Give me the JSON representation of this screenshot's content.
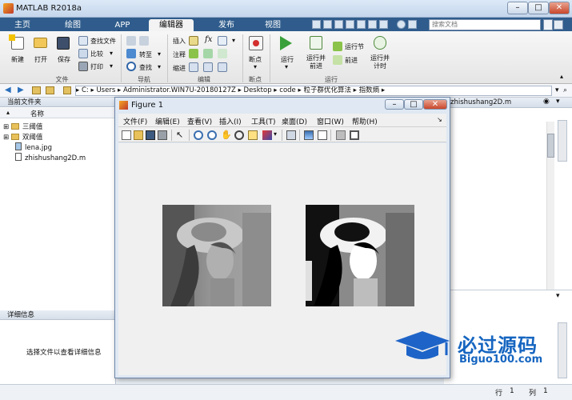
{
  "app": {
    "title": "MATLAB R2018a"
  },
  "tabs": [
    {
      "label": "主页"
    },
    {
      "label": "绘图"
    },
    {
      "label": "APP"
    },
    {
      "label": "编辑器"
    },
    {
      "label": "发布"
    },
    {
      "label": "视图"
    }
  ],
  "search": {
    "placeholder": "搜索文档"
  },
  "ribbon": {
    "new": "新建",
    "open": "打开",
    "save": "保存",
    "find_files": "查找文件",
    "compare": "比较",
    "print": "打印",
    "insert": "插入",
    "comment": "注释",
    "indent": "缩进",
    "goto": "转至",
    "find": "查找",
    "breakpoints": "断点",
    "run": "运行",
    "run_advance": "运行并\n前进",
    "run_section": "运行节",
    "advance": "前进",
    "run_time": "运行并\n计时",
    "groups": {
      "file": "文件",
      "navigate": "导航",
      "edit": "编辑",
      "breakpoints": "断点",
      "run": "运行"
    }
  },
  "address": {
    "path": [
      "C:",
      "Users",
      "Administrator.WIN7U-20180127Z",
      "Desktop",
      "code",
      "粒子群优化算法",
      "指数熵"
    ]
  },
  "current_folder": {
    "title": "当前文件夹",
    "column_name": "名称",
    "items": [
      {
        "name": "三阈值",
        "type": "folder"
      },
      {
        "name": "双阈值",
        "type": "folder"
      },
      {
        "name": "lena.jpg",
        "type": "file"
      },
      {
        "name": "zhishushang2D.m",
        "type": "file"
      }
    ]
  },
  "details": {
    "title": "详细信息",
    "empty_text": "选择文件以查看详细信息"
  },
  "editor_tab": {
    "filename": "zhishushang2D.m"
  },
  "figure": {
    "title": "Figure 1",
    "menu": [
      "文件(F)",
      "编辑(E)",
      "查看(V)",
      "插入(I)",
      "工具(T)",
      "桌面(D)",
      "窗口(W)",
      "帮助(H)"
    ]
  },
  "status": {
    "row_label": "行",
    "row_value": "1",
    "col_label": "列",
    "col_value": "1"
  },
  "watermark": {
    "text": "必过源码",
    "url": "Biguo100.com"
  }
}
